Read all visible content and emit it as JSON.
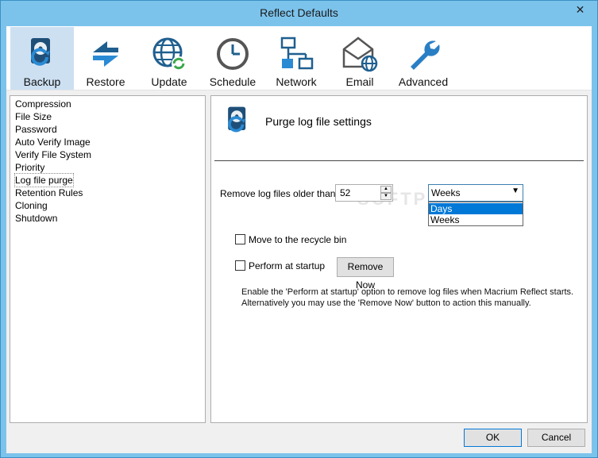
{
  "window": {
    "title": "Reflect Defaults",
    "close_glyph": "✕"
  },
  "toolbar": {
    "items": [
      {
        "label": "Backup",
        "icon": "backup-drive-icon",
        "selected": true
      },
      {
        "label": "Restore",
        "icon": "restore-arrows-icon",
        "selected": false
      },
      {
        "label": "Update",
        "icon": "update-globe-icon",
        "selected": false
      },
      {
        "label": "Schedule",
        "icon": "clock-icon",
        "selected": false
      },
      {
        "label": "Network",
        "icon": "network-icon",
        "selected": false
      },
      {
        "label": "Email",
        "icon": "email-icon",
        "selected": false
      },
      {
        "label": "Advanced",
        "icon": "wrench-icon",
        "selected": false
      }
    ]
  },
  "sidebar": {
    "items": [
      {
        "label": "Compression"
      },
      {
        "label": "File Size"
      },
      {
        "label": "Password"
      },
      {
        "label": "Auto Verify Image"
      },
      {
        "label": "Verify File System"
      },
      {
        "label": "Priority"
      },
      {
        "label": "Log file purge"
      },
      {
        "label": "Retention Rules"
      },
      {
        "label": "Cloning"
      },
      {
        "label": "Shutdown"
      }
    ],
    "selected_index": 6
  },
  "panel": {
    "title": "Purge log file settings",
    "remove_label": "Remove log files older than",
    "age_value": "52",
    "unit_selected": "Weeks",
    "unit_options": [
      "Days",
      "Weeks"
    ],
    "highlighted_option": "Days",
    "recycle_label": "Move to the recycle bin",
    "startup_label": "Perform at startup",
    "remove_now_label": "Remove Now",
    "info_line1": "Enable the 'Perform at startup' option to remove log files when Macrium Reflect starts.",
    "info_line2": "Alternatively you may use the 'Remove Now' button to action this manually.",
    "watermark": "SOFTPEDIA"
  },
  "footer": {
    "ok_label": "OK",
    "cancel_label": "Cancel"
  },
  "colors": {
    "accent": "#0078d7",
    "frame": "#7cc3ec",
    "selected_tool": "#cde0f2",
    "icon_blue": "#1f5f8f"
  }
}
